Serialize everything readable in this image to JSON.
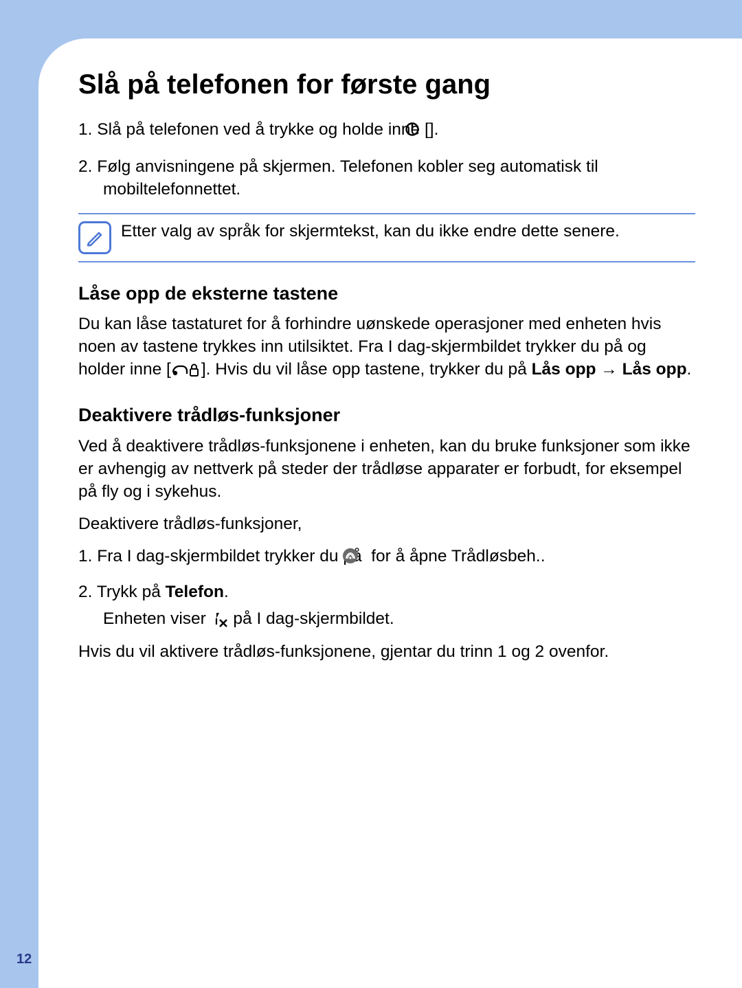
{
  "page_number": "12",
  "title": "Slå på telefonen for første gang",
  "intro_steps": {
    "step1_num": "1.",
    "step1_a": "Slå på telefonen ved å trykke og holde inne [",
    "step1_b": "].",
    "step2_num": "2.",
    "step2": "Følg anvisningene på skjermen. Telefonen kobler seg automatisk til mobiltelefonnettet."
  },
  "note": "Etter valg av språk for skjermtekst, kan du ikke endre dette senere.",
  "section_unlock": {
    "heading": "Låse opp de eksterne tastene",
    "body_a": "Du kan låse tastaturet for å forhindre uønskede operasjoner med enheten hvis noen av tastene trykkes inn utilsiktet. Fra I dag-skjermbildet trykker du på og holder inne [",
    "body_b": "]. Hvis du vil låse opp tastene, trykker du på ",
    "bold1": "Lås opp",
    "arrow": " → ",
    "bold2": "Lås opp",
    "period": "."
  },
  "section_wireless": {
    "heading": "Deaktivere trådløs-funksjoner",
    "intro": "Ved å deaktivere trådløs-funksjonene i enheten, kan du bruke funksjoner som ikke er avhengig av nettverk på steder der trådløse apparater er forbudt, for eksempel på fly og i sykehus.",
    "sub": "Deaktivere trådløs-funksjoner,",
    "step1_num": "1.",
    "step1_a": "Fra I dag-skjermbildet trykker du på ",
    "step1_b": " for å åpne Trådløsbeh..",
    "step2_num": "2.",
    "step2_a": "Trykk på ",
    "step2_bold": "Telefon",
    "step2_b": ".",
    "step2_line2_a": "Enheten viser ",
    "step2_line2_b": " på I dag-skjermbildet.",
    "outro": "Hvis du vil aktivere trådløs-funksjonene, gjentar du trinn 1 og 2 ovenfor."
  }
}
